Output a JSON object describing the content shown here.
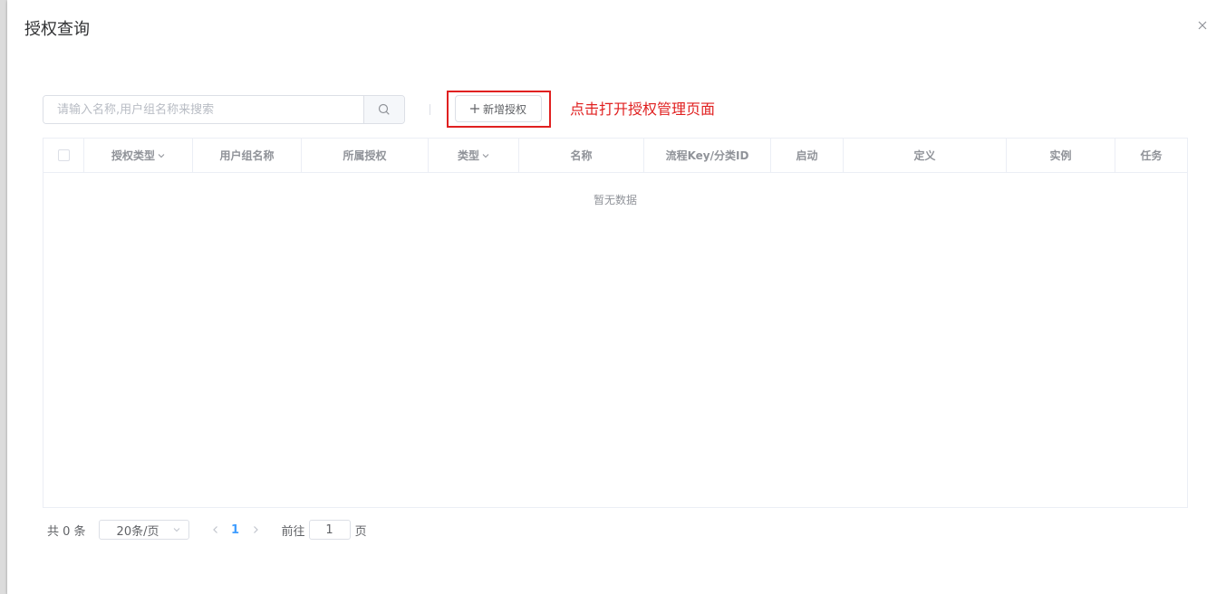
{
  "dialog": {
    "title": "授权查询"
  },
  "toolbar": {
    "search_placeholder": "请输入名称,用户组名称来搜索",
    "add_label": "新增授权"
  },
  "annotation": {
    "text": "点击打开授权管理页面",
    "color": "#e02020"
  },
  "table": {
    "columns": [
      "授权类型",
      "用户组名称",
      "所属授权",
      "类型",
      "名称",
      "流程Key/分类ID",
      "启动",
      "定义",
      "实例",
      "任务"
    ],
    "empty_text": "暂无数据"
  },
  "pagination": {
    "total": "共 0 条",
    "page_size": "20条/页",
    "current_page": "1",
    "jump_prefix": "前往",
    "jump_value": "1",
    "jump_suffix": "页"
  },
  "colors": {
    "accent": "#409eff",
    "annotation_red": "#e02020"
  },
  "icons": {
    "close": "close-icon",
    "search": "search-icon",
    "add": "plus-icon",
    "sort": "chevron-down-icon",
    "prev": "chevron-left-icon",
    "next": "chevron-right-icon"
  }
}
